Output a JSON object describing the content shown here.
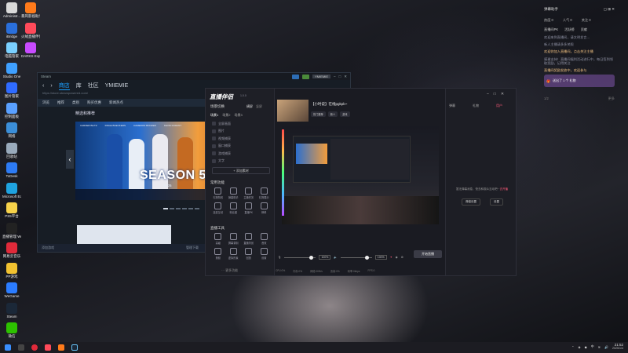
{
  "desktop": {
    "icons": [
      {
        "label": "Administr...",
        "color": "#d9d9d9",
        "icon": "folder-icon"
      },
      {
        "label": "暴风影视助手",
        "color": "#ff7a1a",
        "icon": "app-icon"
      },
      {
        "label": "iBridge",
        "color": "#2a6fdb",
        "icon": "app-icon"
      },
      {
        "label": "火绒直播伴侣",
        "color": "#ff4a5a",
        "icon": "app-icon"
      },
      {
        "label": "电脑管家",
        "color": "#7ad0ff",
        "icon": "app-icon"
      },
      {
        "label": "DARKS Export",
        "color": "#c84bff",
        "icon": "app-icon"
      },
      {
        "label": "Studio One",
        "color": "#3fa0ff",
        "icon": "app-icon"
      },
      {
        "label": "图片管家",
        "color": "#2f6bff",
        "icon": "app-icon"
      },
      {
        "label": "控制面板",
        "color": "#5aa0ff",
        "icon": "control-panel-icon"
      },
      {
        "label": "网络",
        "color": "#3b8ed8",
        "icon": "network-icon"
      },
      {
        "label": "回收站",
        "color": "#9ab",
        "icon": "recycle-bin-icon"
      },
      {
        "label": "ToDesk",
        "color": "#2d7bf4",
        "icon": "app-icon"
      },
      {
        "label": "Microsoft Edge",
        "color": "#1fa3e0",
        "icon": "edge-icon"
      },
      {
        "label": "PS5平台",
        "color": "#f6d24a",
        "icon": "app-icon"
      },
      {
        "label": "直播管理 WeGame",
        "color": "#222",
        "icon": "app-icon"
      },
      {
        "label": "网易云音乐",
        "color": "#e02a3a",
        "icon": "app-icon"
      },
      {
        "label": "PP游戏",
        "color": "#f2c230",
        "icon": "app-icon"
      },
      {
        "label": "WeGame",
        "color": "#2b7cff",
        "icon": "app-icon"
      },
      {
        "label": "Steam",
        "color": "#1b2838",
        "icon": "steam-icon"
      },
      {
        "label": "微信",
        "color": "#2dc100",
        "icon": "wechat-icon"
      }
    ]
  },
  "steam": {
    "title": "Steam",
    "user_btn": "YMIEMIE",
    "nav": {
      "store": "商店",
      "library": "库",
      "community": "社区",
      "user": "YMIEMIE"
    },
    "url": "https://store.steampowered.com/",
    "store_tabs": [
      "浏览",
      "推荐",
      "类别",
      "购买优惠",
      "新闻热点"
    ],
    "featured_label": "精选和推荐",
    "banner": {
      "logo": "SEASON 5",
      "sub": "2K26",
      "players": [
        "CARDER BLITZ",
        "PAIGE BUECKERS",
        "CAMERON BOOZER",
        "KEVIN DURANT"
      ]
    },
    "bottombar": {
      "left": "添加游戏",
      "center": "管理下载",
      "right": "好友与聊天"
    }
  },
  "live": {
    "logo": "直播伴侣",
    "version": "1.0.0",
    "scene_title": "场景切换",
    "scene_tabs": [
      "横屏",
      "竖屏"
    ],
    "source_tabs": [
      "场景1",
      "场景2",
      "场景3"
    ],
    "sources": [
      "全屏画面",
      "图片",
      "视频捕获",
      "窗口捕获",
      "游戏捕获",
      "文字"
    ],
    "add_material": "+ 添加素材",
    "common_title": "常用功能",
    "common_tools": [
      "礼物特效",
      "弹幕助手",
      "主播任务",
      "礼物展示",
      "连麦互动",
      "粉丝团",
      "直播PK",
      "榜单"
    ],
    "extra_title": "直播工具",
    "extra_tools": [
      "高级",
      "屏幕录制",
      "直播背景",
      "音效",
      "美颜",
      "虚拟形象",
      "回放",
      "设置"
    ],
    "more": "··· 更多功能",
    "stream_title": "【小时说】在线pgkpb~",
    "stream_tags": [
      "热门推荐",
      "新人",
      "游戏"
    ],
    "right_tabs": [
      "弹幕",
      "礼物",
      "用户"
    ],
    "chat_empty": "暂无弹幕消息，快去和观众互动吧~",
    "chat_empty_link": "去开播",
    "chat_buttons": [
      "弹幕设置",
      "设置"
    ],
    "mic_label": "麦克风",
    "speaker_label": "扬声器",
    "mic_pct": "100%",
    "speaker_pct": "100%",
    "mic_level": 0.9,
    "speaker_level": 0.9,
    "start_live": "开始直播",
    "status": [
      "CPU:0%",
      "内存:0%",
      "网络:0KB/s",
      "丢帧:0%",
      "码率:0kbps",
      "FPS:0"
    ]
  },
  "side_panel": {
    "title": "弹幕助手",
    "stats": [
      "热度 0",
      "人气 0",
      "关注 0"
    ],
    "tabs": [
      "直播间PK",
      "活跃榜",
      "贡献"
    ],
    "messages": [
      {
        "text": "欢迎来到直播间，请文明发言...",
        "style": "normal"
      },
      {
        "text": "新人主播请多多关照",
        "style": "normal"
      },
      {
        "text": "欢迎你加入直播间，点击关注主播",
        "style": "hl"
      },
      {
        "text": "感谢支持！直播间福利活动进行中，每日签到领取奖励，记得关注",
        "style": "normal"
      },
      {
        "text": "直播间奖励发放中，欢迎参与",
        "style": "hl"
      }
    ],
    "gift_text": "送出了 1 个 礼物",
    "bottom_left": "1/2",
    "bottom_right": "更多"
  },
  "taskbar": {
    "time": "21:52",
    "date": "2025/1/4",
    "lang": "中"
  }
}
